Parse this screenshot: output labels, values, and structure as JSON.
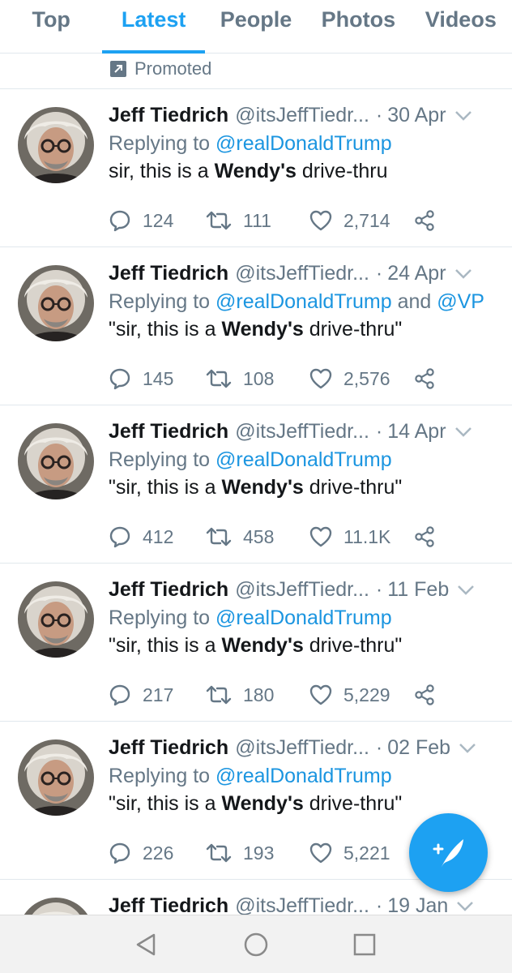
{
  "tabs": [
    {
      "label": "Top",
      "active": false
    },
    {
      "label": "Latest",
      "active": true
    },
    {
      "label": "People",
      "active": false
    },
    {
      "label": "Photos",
      "active": false
    },
    {
      "label": "Videos",
      "active": false
    }
  ],
  "promoted": {
    "label": "Promoted",
    "icon": "promoted-icon"
  },
  "colors": {
    "accent": "#1da1f2",
    "link": "#1b95e0",
    "secondary_text": "#657786",
    "primary_text": "#14171a"
  },
  "tweets": [
    {
      "name": "Jeff Tiedrich",
      "handle": "@itsJeffTiedr...",
      "dot": "·",
      "date": "30 Apr",
      "reply_prefix": "Replying to",
      "mentions": [
        "@realDonaldTrump"
      ],
      "mention_joiner": "",
      "text_before": "sir, this is a ",
      "text_bold": "Wendy's",
      "text_after": " drive-thru",
      "replies": "124",
      "retweets": "111",
      "likes": "2,714"
    },
    {
      "name": "Jeff Tiedrich",
      "handle": "@itsJeffTiedr...",
      "dot": "·",
      "date": "24 Apr",
      "reply_prefix": "Replying to",
      "mentions": [
        "@realDonaldTrump",
        "@VP"
      ],
      "mention_joiner": "and",
      "text_before": "\"sir, this is a ",
      "text_bold": "Wendy's",
      "text_after": " drive-thru\"",
      "replies": "145",
      "retweets": "108",
      "likes": "2,576"
    },
    {
      "name": "Jeff Tiedrich",
      "handle": "@itsJeffTiedr...",
      "dot": "·",
      "date": "14 Apr",
      "reply_prefix": "Replying to",
      "mentions": [
        "@realDonaldTrump"
      ],
      "mention_joiner": "",
      "text_before": "\"sir, this is a ",
      "text_bold": "Wendy's",
      "text_after": " drive-thru\"",
      "replies": "412",
      "retweets": "458",
      "likes": "11.1K"
    },
    {
      "name": "Jeff Tiedrich",
      "handle": "@itsJeffTiedr...",
      "dot": "·",
      "date": "11 Feb",
      "reply_prefix": "Replying to",
      "mentions": [
        "@realDonaldTrump"
      ],
      "mention_joiner": "",
      "text_before": "\"sir, this is a ",
      "text_bold": "Wendy's",
      "text_after": " drive-thru\"",
      "replies": "217",
      "retweets": "180",
      "likes": "5,229"
    },
    {
      "name": "Jeff Tiedrich",
      "handle": "@itsJeffTiedr...",
      "dot": "·",
      "date": "02 Feb",
      "reply_prefix": "Replying to",
      "mentions": [
        "@realDonaldTrump"
      ],
      "mention_joiner": "",
      "text_before": "\"sir, this is a ",
      "text_bold": "Wendy's",
      "text_after": " drive-thru\"",
      "replies": "226",
      "retweets": "193",
      "likes": "5,221"
    }
  ],
  "partial_tweet": {
    "name": "Jeff Tiedrich",
    "handle": "@itsJeffTiedr...",
    "dot": "·",
    "date": "19 Jan"
  },
  "fab": {
    "icon": "compose-tweet-icon"
  },
  "navbar": {
    "icons": [
      "back-icon",
      "home-icon",
      "recent-apps-icon"
    ]
  }
}
